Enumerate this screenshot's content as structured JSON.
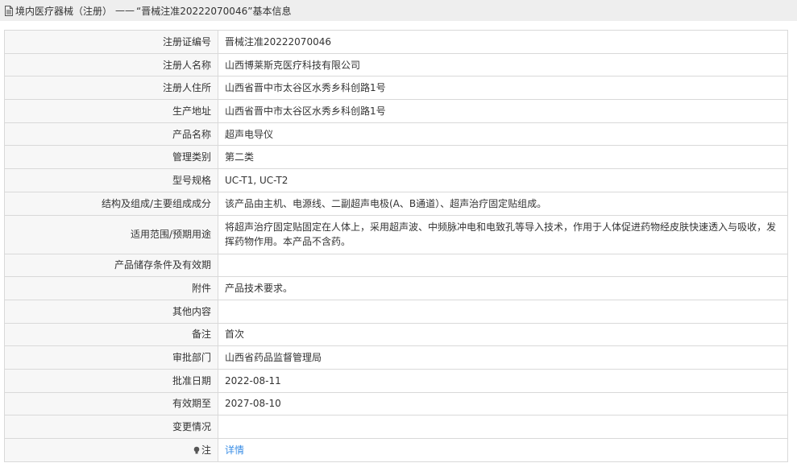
{
  "header": {
    "category": "境内医疗器械（注册）",
    "separator": "——",
    "title_quoted": "“晋械注准20222070046”",
    "suffix": "基本信息"
  },
  "rows": [
    {
      "label": "注册证编号",
      "value": "晋械注准20222070046"
    },
    {
      "label": "注册人名称",
      "value": "山西博莱斯克医疗科技有限公司"
    },
    {
      "label": "注册人住所",
      "value": "山西省晋中市太谷区水秀乡科创路1号"
    },
    {
      "label": "生产地址",
      "value": "山西省晋中市太谷区水秀乡科创路1号"
    },
    {
      "label": "产品名称",
      "value": "超声电导仪"
    },
    {
      "label": "管理类别",
      "value": "第二类"
    },
    {
      "label": "型号规格",
      "value": "UC-T1, UC-T2"
    },
    {
      "label": "结构及组成/主要组成成分",
      "value": "该产品由主机、电源线、二副超声电极(A、B通道）、超声治疗固定贴组成。"
    },
    {
      "label": "适用范围/预期用途",
      "value": "将超声治疗固定贴固定在人体上，采用超声波、中频脉冲电和电致孔等导入技术，作用于人体促进药物经皮肤快速透入与吸收，发挥药物作用。本产品不含药。"
    },
    {
      "label": "产品储存条件及有效期",
      "value": ""
    },
    {
      "label": "附件",
      "value": "产品技术要求。"
    },
    {
      "label": "其他内容",
      "value": ""
    },
    {
      "label": "备注",
      "value": "首次"
    },
    {
      "label": "审批部门",
      "value": "山西省药品监督管理局"
    },
    {
      "label": "批准日期",
      "value": "2022-08-11"
    },
    {
      "label": "有效期至",
      "value": "2027-08-10"
    },
    {
      "label": "变更情况",
      "value": ""
    },
    {
      "label": "注",
      "value": "详情"
    }
  ],
  "icons": {
    "header": "document-icon",
    "note": "lightbulb-icon"
  },
  "colors": {
    "link": "#3a8ee6",
    "label_bg": "#f7f7f7",
    "header_bg": "#eeeeee",
    "border": "#d9d9d9"
  }
}
